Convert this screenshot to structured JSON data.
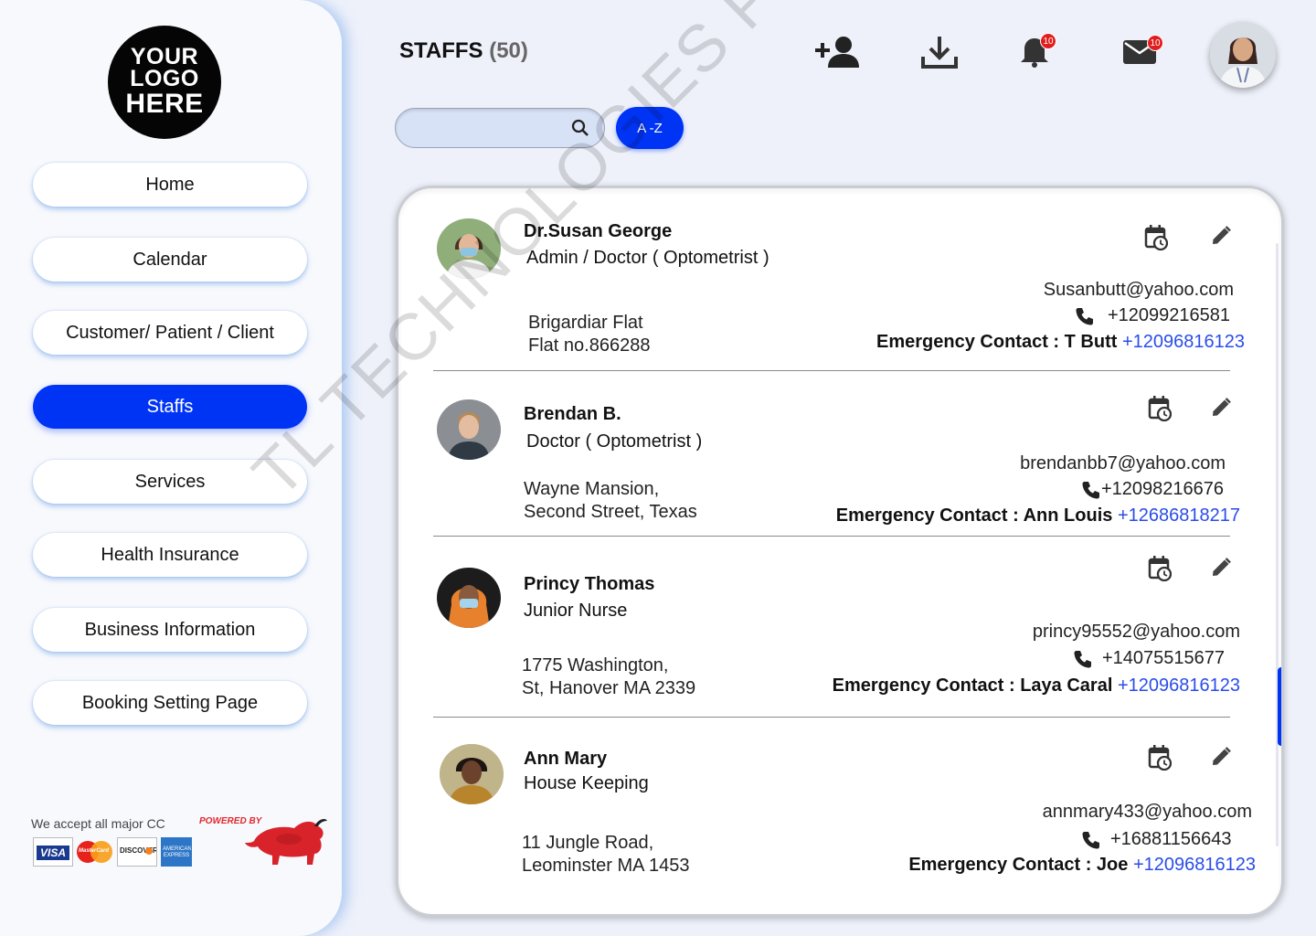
{
  "logo": {
    "line1": "YOUR",
    "line2": "LOGO",
    "line3": "HERE"
  },
  "sidebar": {
    "items": [
      {
        "label": "Home",
        "active": false
      },
      {
        "label": "Calendar",
        "active": false
      },
      {
        "label": "Customer/ Patient / Client",
        "active": false
      },
      {
        "label": "Staffs",
        "active": true
      },
      {
        "label": "Services",
        "active": false
      },
      {
        "label": "Health Insurance",
        "active": false
      },
      {
        "label": "Business Information",
        "active": false
      },
      {
        "label": "Booking Setting Page",
        "active": false
      }
    ],
    "cc_text": "We accept all major CC",
    "cards": [
      "VISA",
      "MasterCard",
      "DISCOVER",
      "AMERICAN EXPRESS"
    ],
    "powered_by": "POWERED BY"
  },
  "header": {
    "title": "STAFFS",
    "count": "(50)",
    "notifications_badge": "10",
    "messages_badge": "10"
  },
  "search": {
    "placeholder": "",
    "sort_label": "A -Z"
  },
  "staff": [
    {
      "name": "Dr.Susan George",
      "role": "Admin / Doctor ( Optometrist )",
      "address_line1": "Brigardiar Flat",
      "address_line2": "Flat no.866288",
      "email": "Susanbutt@yahoo.com",
      "phone": "+12099216581",
      "emergency_label": "Emergency Contact : T Butt",
      "emergency_phone": "+12096816123"
    },
    {
      "name": "Brendan B.",
      "role": "Doctor ( Optometrist )",
      "address_line1": "Wayne Mansion,",
      "address_line2": "Second Street, Texas",
      "email": "brendanbb7@yahoo.com",
      "phone": "+12098216676",
      "emergency_label": "Emergency Contact : Ann Louis",
      "emergency_phone": "+12686818217"
    },
    {
      "name": "Princy Thomas",
      "role": "Junior Nurse",
      "address_line1": "1775 Washington,",
      "address_line2": " St, Hanover MA 2339",
      "email": "princy95552@yahoo.com",
      "phone": "+14075515677",
      "emergency_label": "Emergency Contact : Laya Caral",
      "emergency_phone": "+12096816123"
    },
    {
      "name": "Ann Mary",
      "role": "House Keeping",
      "address_line1": "11 Jungle Road,",
      "address_line2": " Leominster MA 1453",
      "email": "annmary433@yahoo.com",
      "phone": "+16881156643",
      "emergency_label": "Emergency Contact : Joe",
      "emergency_phone": "+12096816123"
    }
  ],
  "watermark": "TL TECHNOLOGIES PRIVATE LIMITED",
  "colors": {
    "accent": "#0034f5",
    "link": "#2a4de8",
    "badge": "#e11d1d"
  },
  "icons": [
    "add-user-icon",
    "download-icon",
    "bell-icon",
    "mail-icon",
    "search-icon",
    "calendar-clock-icon",
    "edit-pencil-icon",
    "phone-icon"
  ]
}
